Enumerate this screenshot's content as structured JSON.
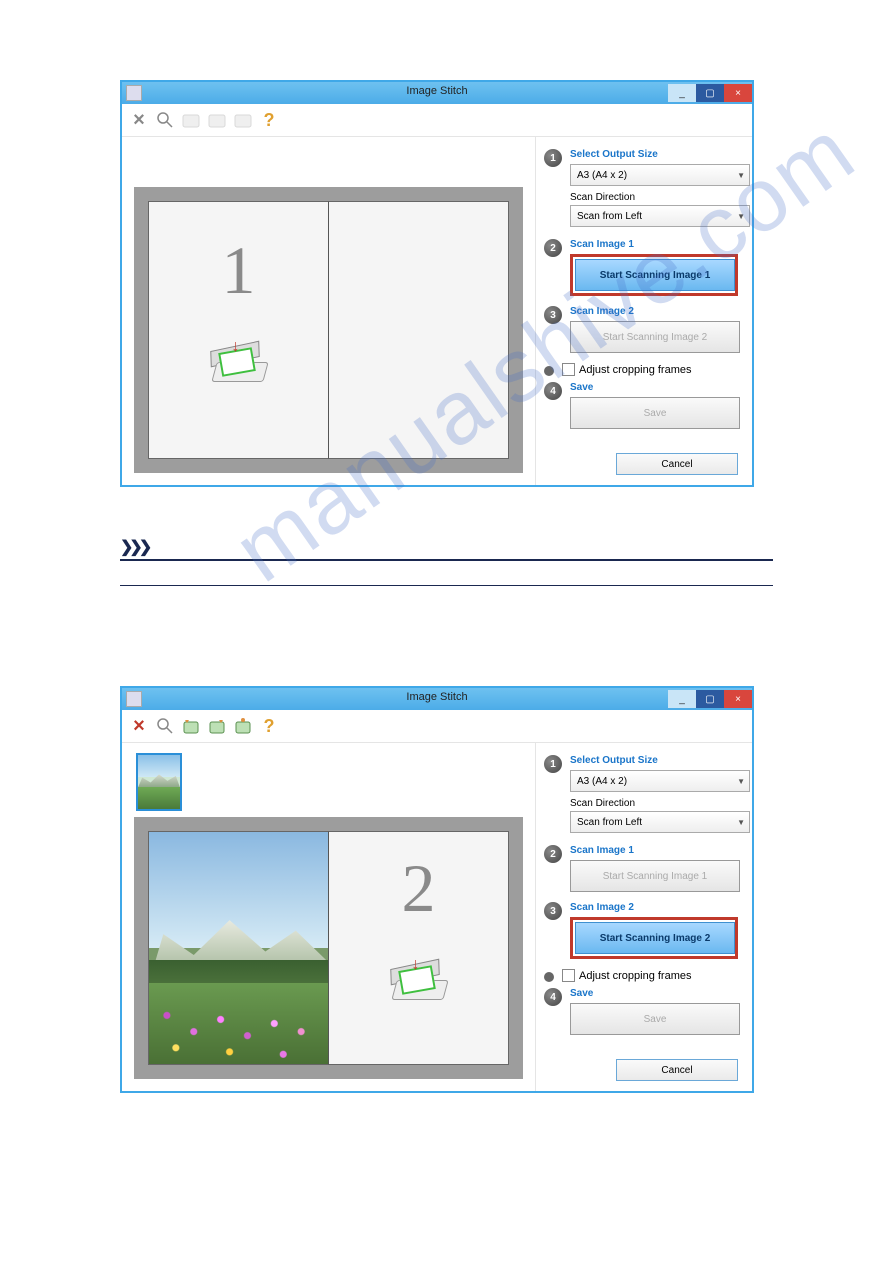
{
  "dialog": {
    "title": "Image Stitch",
    "window_controls": {
      "min": "_",
      "max": "▢",
      "close": "×"
    },
    "toolbar_icons": {
      "delete": "×",
      "zoom": "zoom-icon",
      "rotate1": "rotate-icon",
      "rotate2": "rotate-icon",
      "rotate3": "rotate-icon",
      "help": "?"
    },
    "preview": {
      "placeholder_1": "1",
      "placeholder_2": "2"
    },
    "side": {
      "step1": {
        "title": "Select Output Size",
        "output_size_label": "Output Size",
        "output_size_value": "A3 (A4 x 2)",
        "scan_direction_label": "Scan Direction",
        "scan_direction_value": "Scan from Left"
      },
      "step2": {
        "title": "Scan Image 1",
        "button": "Start Scanning Image 1"
      },
      "step3": {
        "title": "Scan Image 2",
        "button": "Start Scanning Image 2"
      },
      "adjust_crop": "Adjust cropping frames",
      "step4": {
        "title": "Save",
        "button": "Save"
      },
      "cancel": "Cancel"
    }
  },
  "watermark": "manualshive.com"
}
